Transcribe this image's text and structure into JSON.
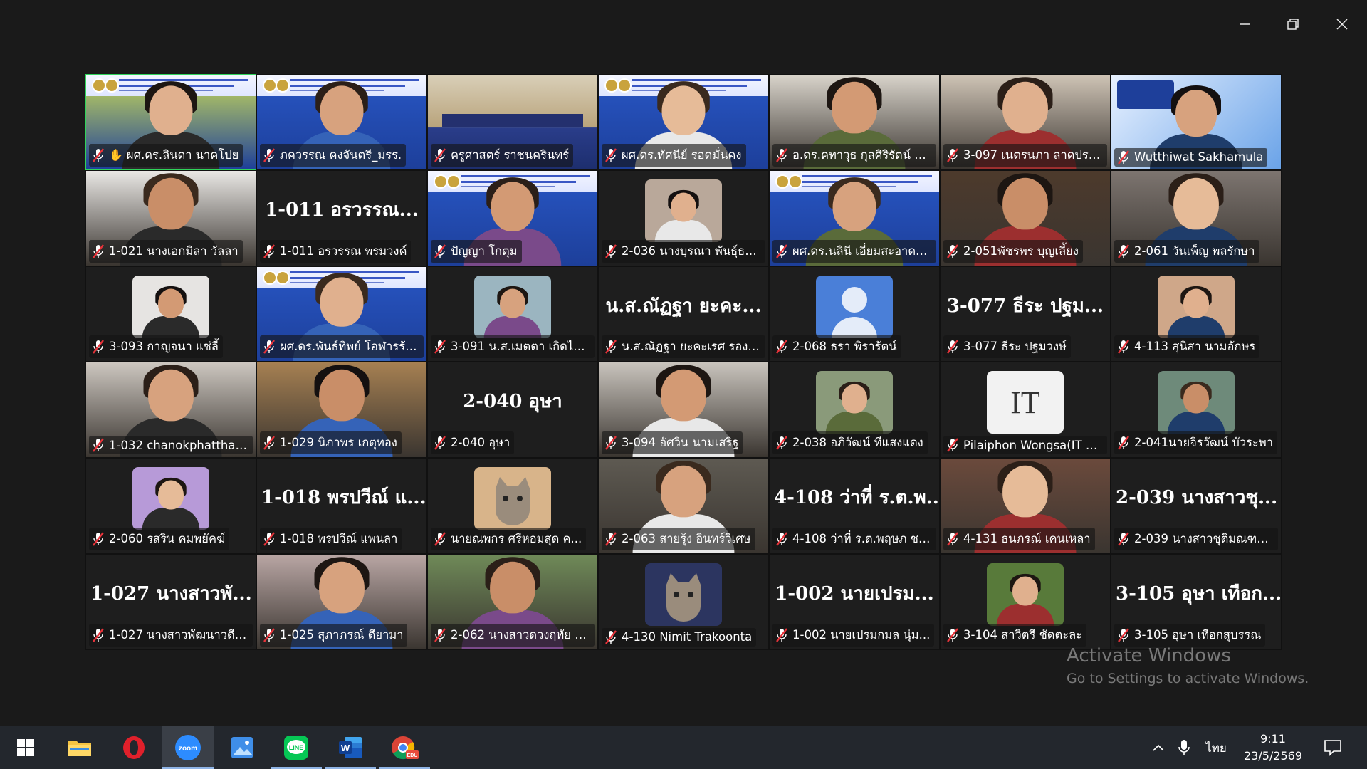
{
  "window": {
    "minimize_icon": "minimize-icon",
    "restore_icon": "restore-icon",
    "close_icon": "close-icon"
  },
  "participants": [
    {
      "name": "ผศ.ดร.ลินดา นาคโปย",
      "video": "banner",
      "speaking": true,
      "hand": true,
      "bg": "#c7d95a"
    },
    {
      "name": "ภควรรณ คงจันตรี_มรร.",
      "video": "banner",
      "bg": "#2856c4"
    },
    {
      "name": "ครูศาสตร์ ราชนครินทร์",
      "video": "room",
      "bg": "#c9b58c"
    },
    {
      "name": "ผศ.ดร.ทัศนีย์ รอดมั่นคง",
      "video": "banner",
      "bg": "#2856c4"
    },
    {
      "name": "อ.ดร.คทาวุธ กุลศิริรัตน์ มรร.",
      "video": "cam",
      "bg": "#d9d4cb"
    },
    {
      "name": "3-097 เนตรนภา ลาดประ...",
      "video": "cam",
      "bg": "#cfc4b6"
    },
    {
      "name": "Wutthiwat Sakhamula",
      "video": "poster",
      "bg": "#6aa3e8"
    },
    {
      "name": "1-021 นางเอกมิลา วัลลา",
      "video": "cam",
      "bg": "#e9e7e4"
    },
    {
      "name": "1-011 อรวรรณ พรมวงค์",
      "video": "none",
      "big": "1-011 อรวรรณ..."
    },
    {
      "name": "ปัญญา โกตุม",
      "video": "banner",
      "bg": "#2856c4"
    },
    {
      "name": "2-036 นางบุรณา พันธุ์ธร...",
      "video": "thumb",
      "bg": "#b9a89a"
    },
    {
      "name": "ผศ.ดร.นลินี เอี่ยมสะอาด_ม...",
      "video": "banner",
      "bg": "#2856c4"
    },
    {
      "name": "2-051พัชรพร บุญเลี้ยง",
      "video": "cam",
      "bg": "#4d3a2c"
    },
    {
      "name": "2-061 วันเพ็ญ พลรักษา",
      "video": "cam",
      "bg": "#7d7570"
    },
    {
      "name": "3-093 กาญจนา แซ่ลี้",
      "video": "thumb",
      "bg": "#e6e4e2"
    },
    {
      "name": "ผศ.ดร.พันธ์ทิพย์ โอฬารรัต...",
      "video": "banner",
      "bg": "#2856c4"
    },
    {
      "name": "3-091 น.ส.เมตตา เกิดไพ...",
      "video": "thumb",
      "bg": "#9bb5c0"
    },
    {
      "name": "น.ส.ณัฏฐา ยะคะเรศ รอง ผ...",
      "video": "none",
      "big": "น.ส.ณัฏฐา ยะคะ..."
    },
    {
      "name": "2-068 ธรา พิรารัตน์",
      "video": "avatar",
      "bg": "#4a7fd8"
    },
    {
      "name": "3-077 ธีระ ปฐมวงษ์",
      "video": "none",
      "big": "3-077 ธีระ ปฐม..."
    },
    {
      "name": "4-113 สุนิสา นามอักษร",
      "video": "thumb",
      "bg": "#cfa789"
    },
    {
      "name": "1-032 chanokphattharin",
      "video": "cam",
      "bg": "#cdc7c0"
    },
    {
      "name": "1-029 นิภาพร เกตุทอง",
      "video": "cam",
      "bg": "#a68052"
    },
    {
      "name": "2-040 อุษา",
      "video": "none",
      "big": "2-040 อุษา"
    },
    {
      "name": "3-094 อัศวิน นามเสริฐ",
      "video": "cam",
      "bg": "#c9c4bd"
    },
    {
      "name": "2-038 อภิวัฒน์ ทีแสงแดง",
      "video": "thumb",
      "bg": "#8a9a7a"
    },
    {
      "name": "Pilaiphon Wongsa(IT S...",
      "video": "logo",
      "bg": "#f2f2f2",
      "logo_text": "IT"
    },
    {
      "name": "2-041นายจิรวัฒน์ บัวระพา",
      "video": "thumb",
      "bg": "#6e8a7a"
    },
    {
      "name": "2-060 รสริน คมพยัคฆ์",
      "video": "thumb",
      "bg": "#b79ad8"
    },
    {
      "name": "1-018 พรปวีณ์ แพนลา",
      "video": "none",
      "big": "1-018 พรปวีณ์ แ..."
    },
    {
      "name": "นายณพกร ศรีหอมสุด ค...",
      "video": "cat",
      "bg": "#d8b48a"
    },
    {
      "name": "2-063 สายรุ้ง อินทร์วิเศษ",
      "video": "cam",
      "bg": "#5e5a52"
    },
    {
      "name": "4-108 ว่าที่ ร.ต.พฤษภ ชอ...",
      "video": "none",
      "big": "4-108 ว่าที่ ร.ต.พ..."
    },
    {
      "name": "4-131 ธนภรณ์ เคนเหลา",
      "video": "cam",
      "bg": "#6b4a3c"
    },
    {
      "name": "2-039 นางสาวชุติมณฑน์ ...",
      "video": "none",
      "big": "2-039 นางสาวชุ..."
    },
    {
      "name": "1-027 นางสาวพัฒนาวดี ...",
      "video": "none",
      "big": "1-027 นางสาวพั..."
    },
    {
      "name": "1-025 สุภาภรณ์ ดียามา",
      "video": "cam",
      "bg": "#b9a6a4"
    },
    {
      "name": "2-062 นางสาวดวงฤทัย ส...",
      "video": "cam",
      "bg": "#6f8a58"
    },
    {
      "name": "4-130 Nimit Trakoonta",
      "video": "cat",
      "bg": "#2c3560"
    },
    {
      "name": "1-002 นายเปรมกมล นุ่ม...",
      "video": "none",
      "big": "1-002 นายเปรม..."
    },
    {
      "name": "3-104 สาวิตรี ชัดตะละ",
      "video": "thumb",
      "bg": "#587a3a"
    },
    {
      "name": "3-105 อุษา เทือกสุบรรณ",
      "video": "none",
      "big": "3-105 อุษา เทือก..."
    }
  ],
  "watermark": {
    "line1": "Activate Windows",
    "line2": "Go to Settings to activate Windows."
  },
  "taskbar": {
    "apps": [
      {
        "name": "start-button",
        "icon": "windows-icon"
      },
      {
        "name": "file-explorer",
        "icon": "folder-icon"
      },
      {
        "name": "opera",
        "icon": "opera-icon"
      },
      {
        "name": "zoom",
        "icon": "zoom-icon",
        "label": "zoom",
        "active": true
      },
      {
        "name": "photos",
        "icon": "photos-icon"
      },
      {
        "name": "line",
        "icon": "line-icon",
        "label": "LINE"
      },
      {
        "name": "word",
        "icon": "word-icon",
        "label": "W"
      },
      {
        "name": "chrome",
        "icon": "chrome-icon",
        "label": "EDU"
      }
    ],
    "language": "ไทย",
    "time": "9:11",
    "date": "23/5/2569"
  }
}
